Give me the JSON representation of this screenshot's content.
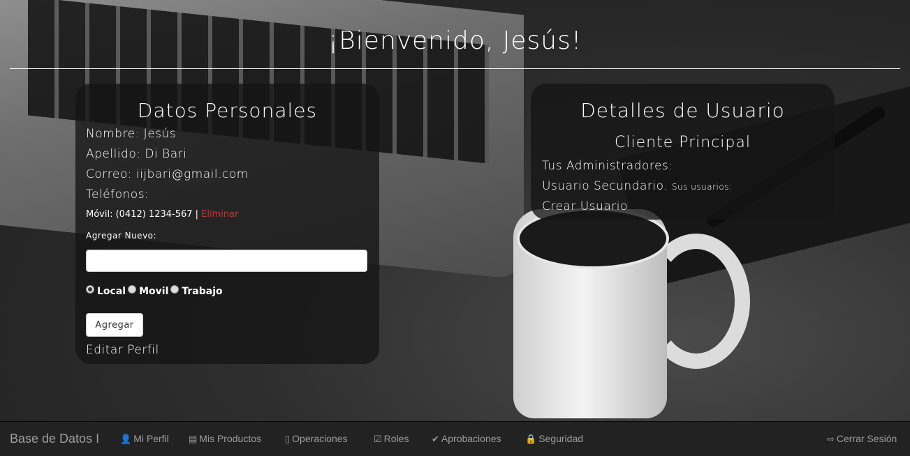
{
  "header": {
    "title": "¡Bienvenido, Jesús!"
  },
  "personal": {
    "title": "Datos Personales",
    "nombre": "Nombre: Jesús",
    "apellido": "Apellido: Di Bari",
    "correo": "Correo: iijbari@gmail.com",
    "telefonos": "Teléfonos:",
    "phone_entry": "Móvil: (0412) 1234-567 |",
    "delete_label": "Eliminar",
    "add_new_label": "Agregar Nuevo:",
    "phone_input_value": "",
    "radios": [
      {
        "label": "Local",
        "checked": true
      },
      {
        "label": "Movil",
        "checked": false
      },
      {
        "label": "Trabajo",
        "checked": false
      }
    ],
    "add_button": "Agregar",
    "edit_profile": "Editar Perfil"
  },
  "user_details": {
    "title": "Detalles de Usuario",
    "role": "Cliente Principal",
    "admins": "Tus Administradores:",
    "secondary": "Usuario Secundario.",
    "secondary_small": "Sus usuarios:",
    "create_user": "Crear Usuario"
  },
  "navbar": {
    "brand": "Base de Datos I",
    "items": [
      {
        "label": "Mi Perfil",
        "icon": "user-icon"
      },
      {
        "label": "Mis Productos",
        "icon": "credit-card-icon"
      },
      {
        "label": "Operaciones",
        "icon": "phone-icon"
      },
      {
        "label": "Roles",
        "icon": "check-square-icon"
      },
      {
        "label": "Aprobaciones",
        "icon": "checkmark-icon"
      },
      {
        "label": "Seguridad",
        "icon": "lock-icon"
      }
    ],
    "logout": {
      "label": "Cerrar Sesión",
      "icon": "logout-icon"
    }
  }
}
